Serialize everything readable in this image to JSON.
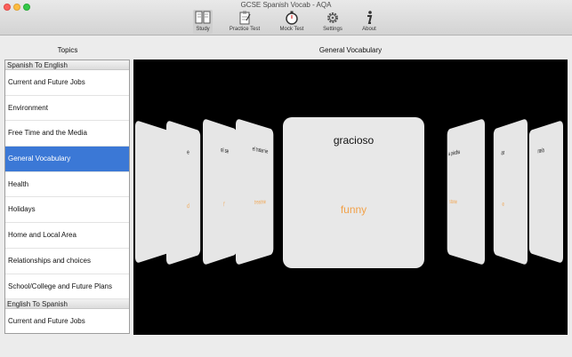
{
  "window": {
    "title": "GCSE Spanish Vocab - AQA"
  },
  "toolbar": {
    "study": {
      "label": "Study",
      "icon": "book-icon"
    },
    "practice": {
      "label": "Practice Test",
      "icon": "clipboard-icon"
    },
    "mock": {
      "label": "Mock Test",
      "icon": "stopwatch-icon"
    },
    "settings": {
      "label": "Settings",
      "icon": "gear-icon"
    },
    "about": {
      "label": "About",
      "icon": "info-icon"
    }
  },
  "sidebar": {
    "header": "Topics",
    "sections": [
      {
        "title": "Spanish To English",
        "items": [
          "Current and Future Jobs",
          "Environment",
          "Free Time and the Media",
          "General Vocabulary",
          "Health",
          "Holidays",
          "Home and Local Area",
          "Relationships and choices",
          "School/College and Future Plans"
        ]
      },
      {
        "title": "English To Spanish",
        "items": [
          "Current and Future Jobs"
        ]
      }
    ],
    "selected": "General Vocabulary"
  },
  "main": {
    "header": "General Vocabulary",
    "center_card": {
      "word": "gracioso",
      "translation": "funny"
    },
    "left_cards": [
      {
        "word": "e",
        "translation": "d"
      },
      {
        "word": "el se",
        "translation": "f"
      },
      {
        "word": "el tratamie",
        "translation": "treatme"
      }
    ],
    "right_cards": [
      {
        "word": "a piedra",
        "translation": "stone"
      },
      {
        "word": "ar",
        "translation": "e"
      },
      {
        "word": "ro/a",
        "translation": ""
      }
    ]
  }
}
